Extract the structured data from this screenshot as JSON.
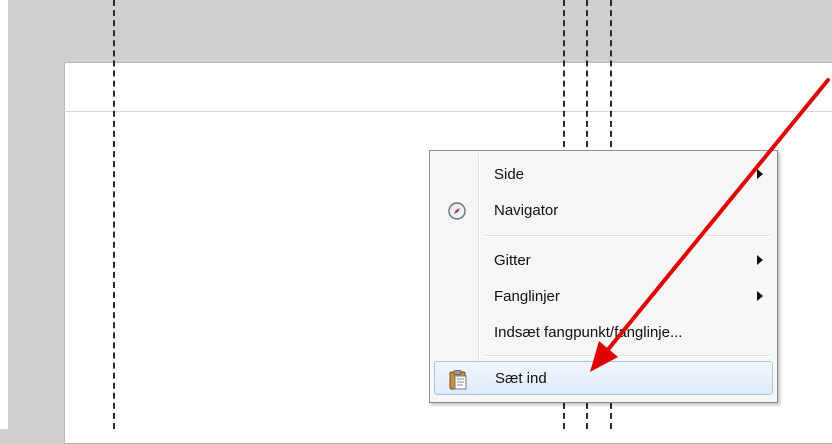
{
  "context_menu": {
    "items": [
      {
        "label": "Side",
        "has_submenu": true,
        "icon": ""
      },
      {
        "label": "Navigator",
        "has_submenu": false,
        "icon": "compass-icon"
      },
      {
        "label": "Gitter",
        "has_submenu": true,
        "icon": ""
      },
      {
        "label": "Fanglinjer",
        "has_submenu": true,
        "icon": ""
      },
      {
        "label": "Indsæt fangpunkt/fanglinje...",
        "has_submenu": false,
        "icon": ""
      },
      {
        "label": "Sæt ind",
        "has_submenu": false,
        "icon": "clipboard-paste-icon",
        "highlighted": true
      }
    ]
  },
  "colors": {
    "canvas_background": "#cfcfcf",
    "page": "#ffffff",
    "menu_background": "#f6f6f6",
    "highlight_border": "#a8c6ec",
    "annotation_arrow": "#e00000"
  }
}
